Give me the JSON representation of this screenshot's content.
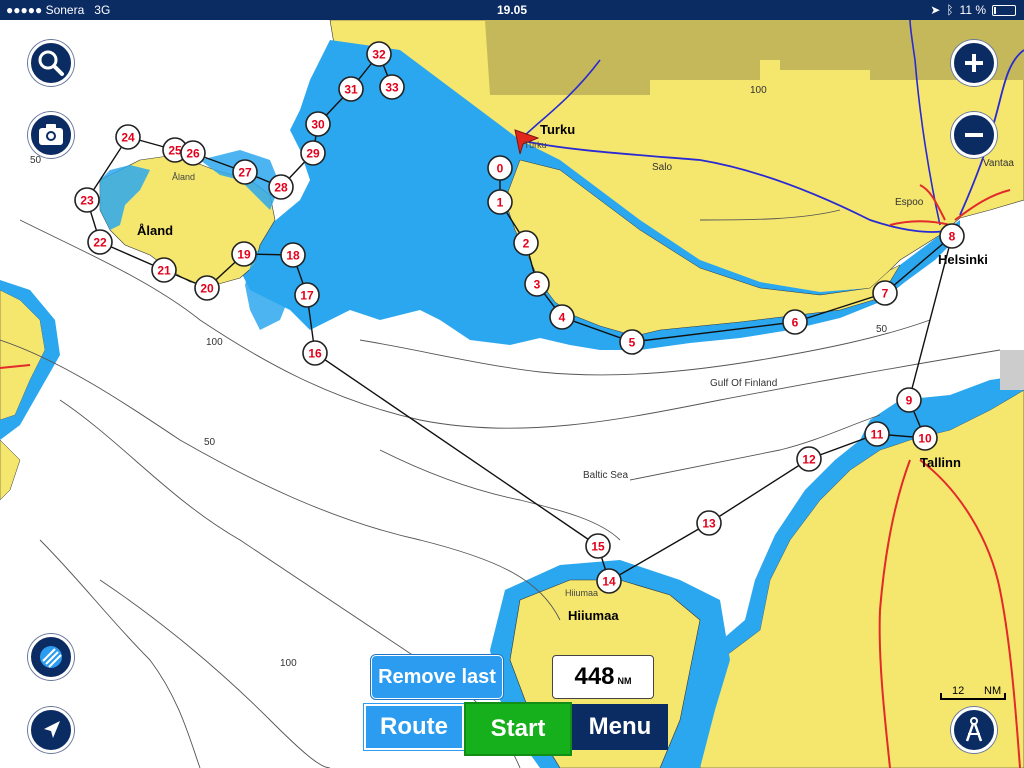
{
  "status_bar": {
    "carrier": "●●●●● Sonera",
    "network": "3G",
    "time": "19.05",
    "battery": "11 %",
    "battery_level": 0.11
  },
  "map": {
    "place_labels": [
      {
        "id": "turku",
        "text": "Turku"
      },
      {
        "id": "aland",
        "text": "Åland"
      },
      {
        "id": "helsinki",
        "text": "Helsinki"
      },
      {
        "id": "tallinn",
        "text": "Tallinn"
      },
      {
        "id": "hiiumaa",
        "text": "Hiiumaa"
      },
      {
        "id": "salo",
        "text": "Salo"
      },
      {
        "id": "espoo",
        "text": "Espoo"
      },
      {
        "id": "vantaa",
        "text": "Vantaa"
      },
      {
        "id": "gulf",
        "text": "Gulf Of Finland"
      },
      {
        "id": "baltic",
        "text": "Baltic Sea"
      },
      {
        "id": "aland_small",
        "text": "Åland"
      },
      {
        "id": "turku_small",
        "text": "Turku"
      },
      {
        "id": "hiiumaa_small",
        "text": "Hiiumaa"
      }
    ],
    "depth_labels": [
      "50",
      "100",
      "50",
      "100",
      "50",
      "100"
    ],
    "waypoints": [
      "0",
      "1",
      "2",
      "3",
      "4",
      "5",
      "6",
      "7",
      "8",
      "9",
      "10",
      "11",
      "12",
      "13",
      "14",
      "15",
      "16",
      "17",
      "18",
      "19",
      "20",
      "21",
      "22",
      "23",
      "24",
      "25",
      "26",
      "27",
      "28",
      "29",
      "30",
      "31",
      "32",
      "33"
    ]
  },
  "controls": {
    "search_icon": "search-icon",
    "camera_icon": "camera-icon",
    "layers_icon": "layers-icon",
    "locate_icon": "navigation-arrow-icon",
    "zoom_in_icon": "plus-icon",
    "zoom_out_icon": "minus-icon",
    "compass_icon": "divider-compass-icon"
  },
  "route_panel": {
    "remove_last_label": "Remove last",
    "distance_value": "448",
    "distance_unit": "NM",
    "route_label": "Route",
    "start_label": "Start",
    "menu_label": "Menu"
  },
  "scale": {
    "value": "12",
    "unit": "NM"
  },
  "colors": {
    "land": "#f5e66e",
    "shallow_water": "#2ba7ef",
    "deep_water": "#ffffff",
    "navy": "#0b2b63",
    "start_green": "#16b01c",
    "route_blue": "#2b9cf0",
    "waypoint_number": "#e3001b"
  }
}
